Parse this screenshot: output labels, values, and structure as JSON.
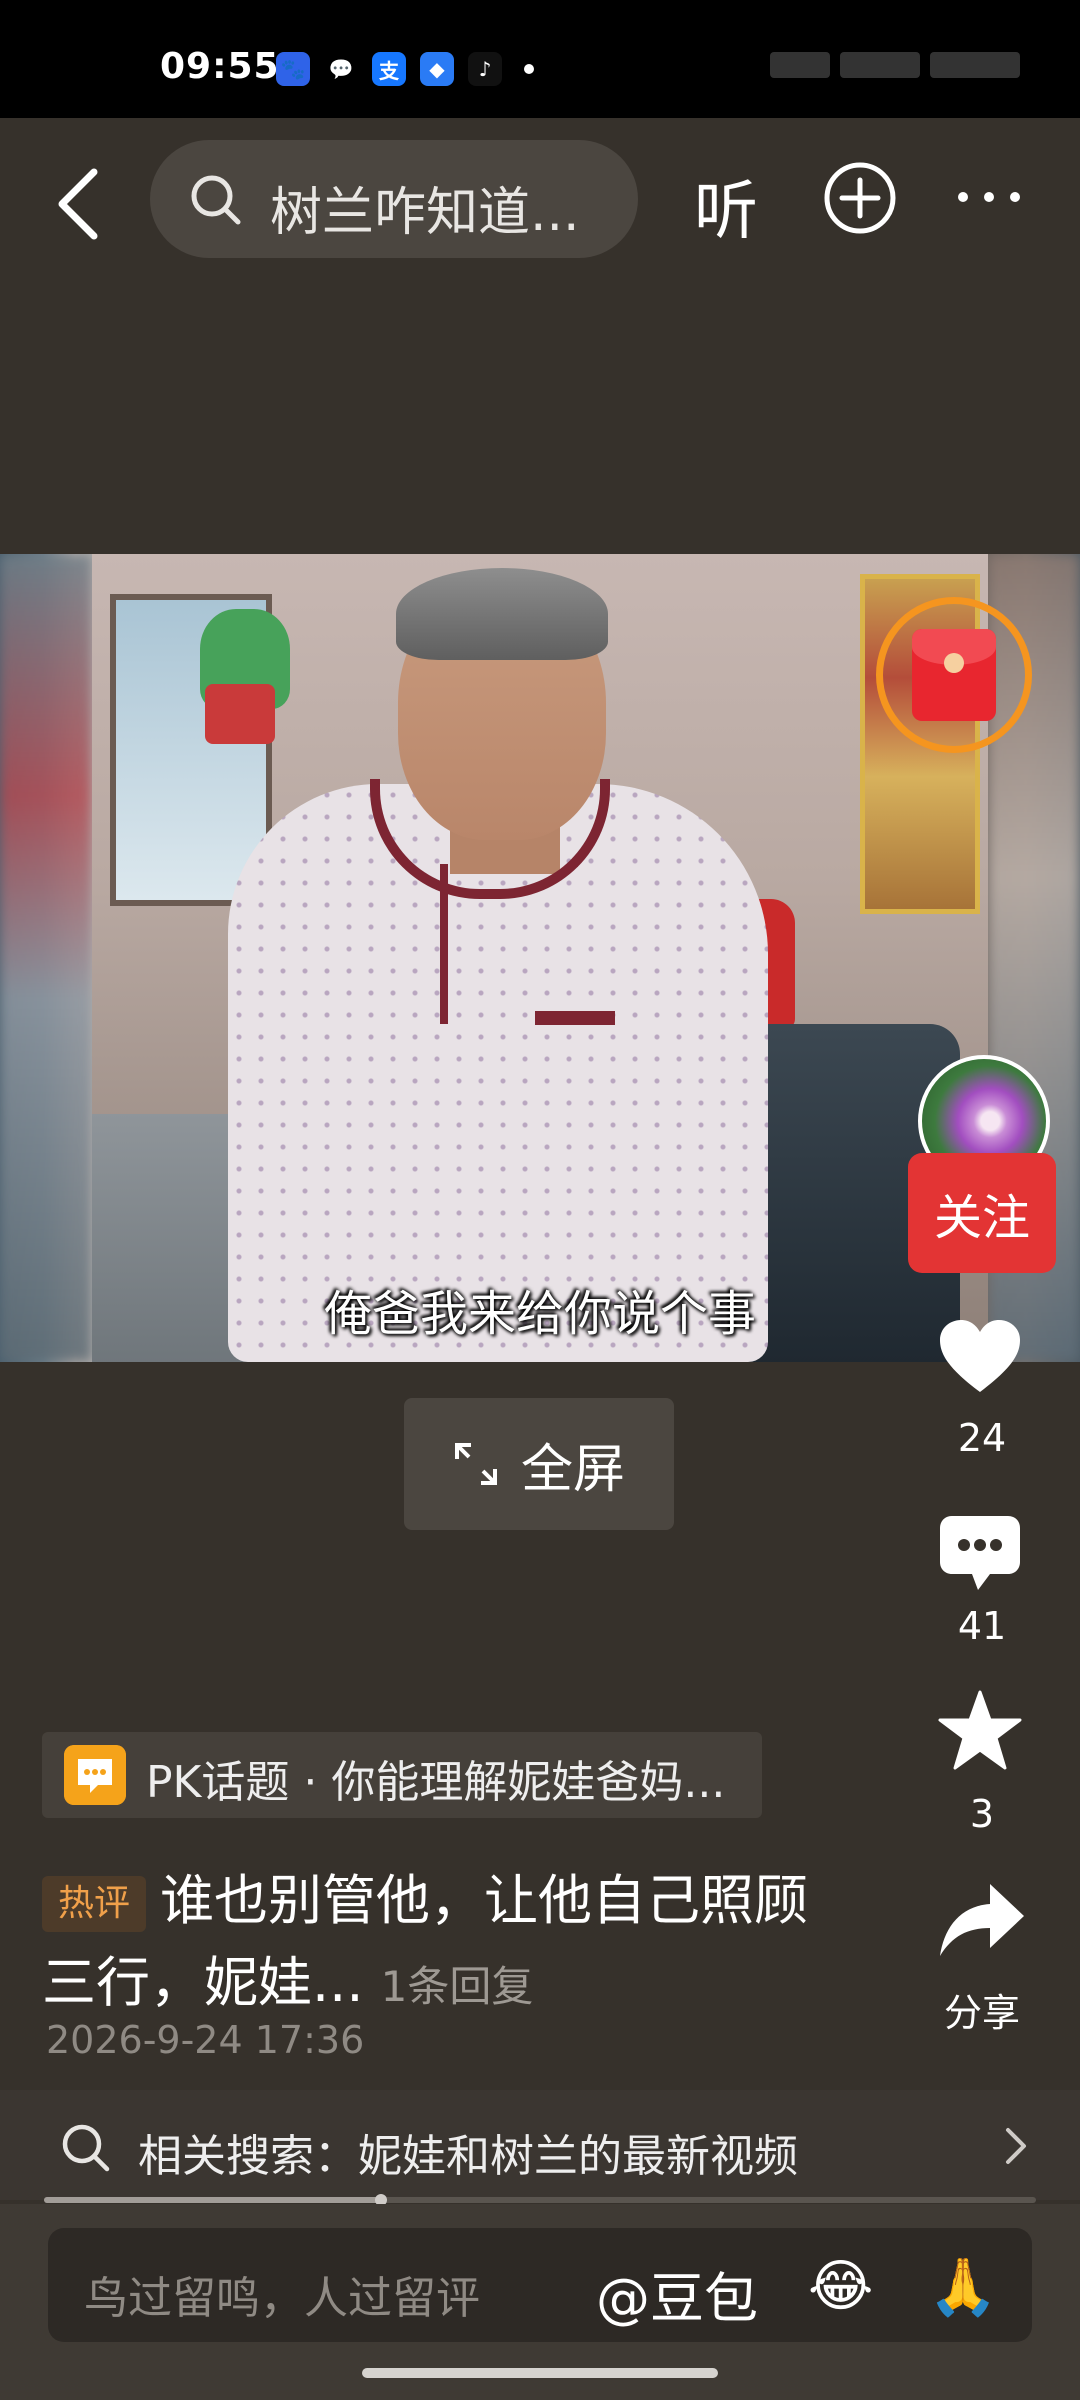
{
  "status_bar": {
    "time": "09:55",
    "apps": [
      {
        "name": "baidu-icon",
        "glyph": "🐾",
        "bg": "#2f63e8"
      },
      {
        "name": "wechat-icon",
        "glyph": "💬",
        "bg": "transparent"
      },
      {
        "name": "alipay-icon",
        "glyph": "支",
        "bg": "#1677ff"
      },
      {
        "name": "browser-icon",
        "glyph": "◆",
        "bg": "#2a7bf5"
      },
      {
        "name": "tiktok-icon",
        "glyph": "♪",
        "bg": "#111111"
      }
    ]
  },
  "top_nav": {
    "search_text": "树兰咋知道...",
    "listen_label": "听"
  },
  "video": {
    "subtitle": "俺爸我来给你说个事"
  },
  "right_rail": {
    "follow_label": "关注",
    "likes": "24",
    "comments": "41",
    "favorites": "3",
    "share_label": "分享"
  },
  "fullscreen_label": "全屏",
  "pk_topic": {
    "text": "PK话题 · 你能理解妮娃爸妈..."
  },
  "hot_comment": {
    "badge": "热评",
    "text": "谁也别管他，让他自己照顾三行，妮娃...",
    "reply_count": "1条回复",
    "date": "2026-9-24 17:36"
  },
  "related_search": {
    "text": "相关搜索：妮娃和树兰的最新视频"
  },
  "progress": {
    "fraction": 0.34
  },
  "comment_bar": {
    "placeholder": "鸟过留鸣，人过留评",
    "mention": "@豆包",
    "emoji_1": "😂",
    "emoji_2": "🙏"
  },
  "colors": {
    "background": "#36312b",
    "accent_red": "#e33434",
    "envelope_ring": "#f5951f",
    "pk_icon": "#f5a31a"
  }
}
